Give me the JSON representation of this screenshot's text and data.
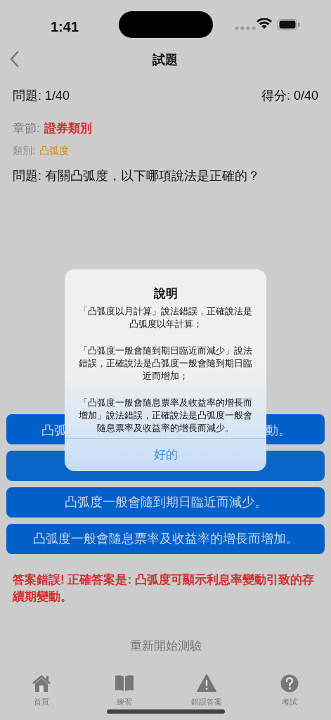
{
  "status_bar": {
    "time": "1:41"
  },
  "nav": {
    "title": "試題"
  },
  "progress": {
    "question": "問題: 1/40",
    "score": "得分: 0/40"
  },
  "chapter": {
    "label": "章節:",
    "value": "證券類別"
  },
  "category": {
    "label": "類別:",
    "value": "凸弧度"
  },
  "question": "問題: 有關凸弧度，以下哪項說法是正確的？",
  "options": [
    {
      "kind": "partial",
      "visible_start": "凸弧",
      "visible_end": "動。"
    },
    {
      "kind": "covered"
    },
    {
      "kind": "full",
      "text": "凸弧度一般會隨到期日臨近而減少。"
    },
    {
      "kind": "full",
      "text": "凸弧度一般會隨息票率及收益率的增長而增加。"
    }
  ],
  "feedback": "答案錯誤! 正確答案是: 凸弧度可顯示利息率變動引致的存續期變動。",
  "restart": "重新開始測驗",
  "tabs": [
    {
      "kind": "home",
      "label": "首頁",
      "selected": false
    },
    {
      "kind": "book",
      "label": "練習",
      "selected": false
    },
    {
      "kind": "warning",
      "label": "錯誤答案",
      "selected": false
    },
    {
      "kind": "question",
      "label": "考試",
      "selected": false
    }
  ],
  "alert": {
    "title": "說明",
    "paragraphs": [
      "「凸弧度以月計算」說法錯誤，正確說法是凸弧度以年計算；",
      "「凸弧度一般會隨到期日臨近而減少」說法錯誤，正確說法是凸弧度一般會隨到期日臨近而增加；",
      "「凸弧度一般會隨息票率及收益率的增長而增加」說法錯誤，正確說法是凸弧度一般會隨息票率及收益率的增長而減少。"
    ],
    "button": "好的"
  }
}
